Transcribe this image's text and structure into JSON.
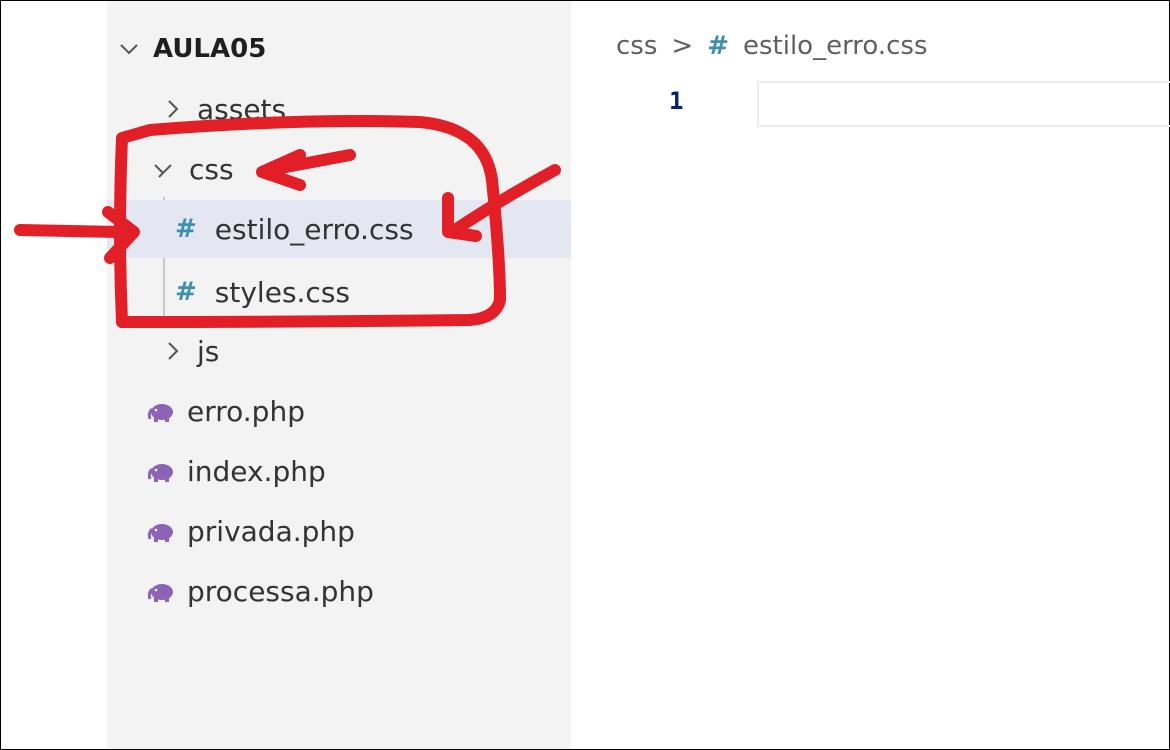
{
  "explorer": {
    "root_label": "AULA05",
    "items": [
      {
        "label": "assets",
        "kind": "folder",
        "expanded": false
      },
      {
        "label": "css",
        "kind": "folder",
        "expanded": true
      },
      {
        "label": "estilo_erro.css",
        "kind": "css-file",
        "icon": "#",
        "selected": true
      },
      {
        "label": "styles.css",
        "kind": "css-file",
        "icon": "#"
      },
      {
        "label": "js",
        "kind": "folder",
        "expanded": false
      },
      {
        "label": "erro.php",
        "kind": "php-file"
      },
      {
        "label": "index.php",
        "kind": "php-file"
      },
      {
        "label": "privada.php",
        "kind": "php-file"
      },
      {
        "label": "processa.php",
        "kind": "php-file"
      }
    ]
  },
  "editor": {
    "breadcrumb": {
      "folder": "css",
      "separator": ">",
      "icon": "#",
      "file": "estilo_erro.css"
    },
    "line_number": "1"
  },
  "colors": {
    "sidebar_bg": "#f3f3f3",
    "selected_bg": "#e4e6f1",
    "css_icon": "#3c8fb0",
    "php_icon": "#8c63b6",
    "annotation": "#e21f26",
    "line_number": "#0b216f"
  }
}
